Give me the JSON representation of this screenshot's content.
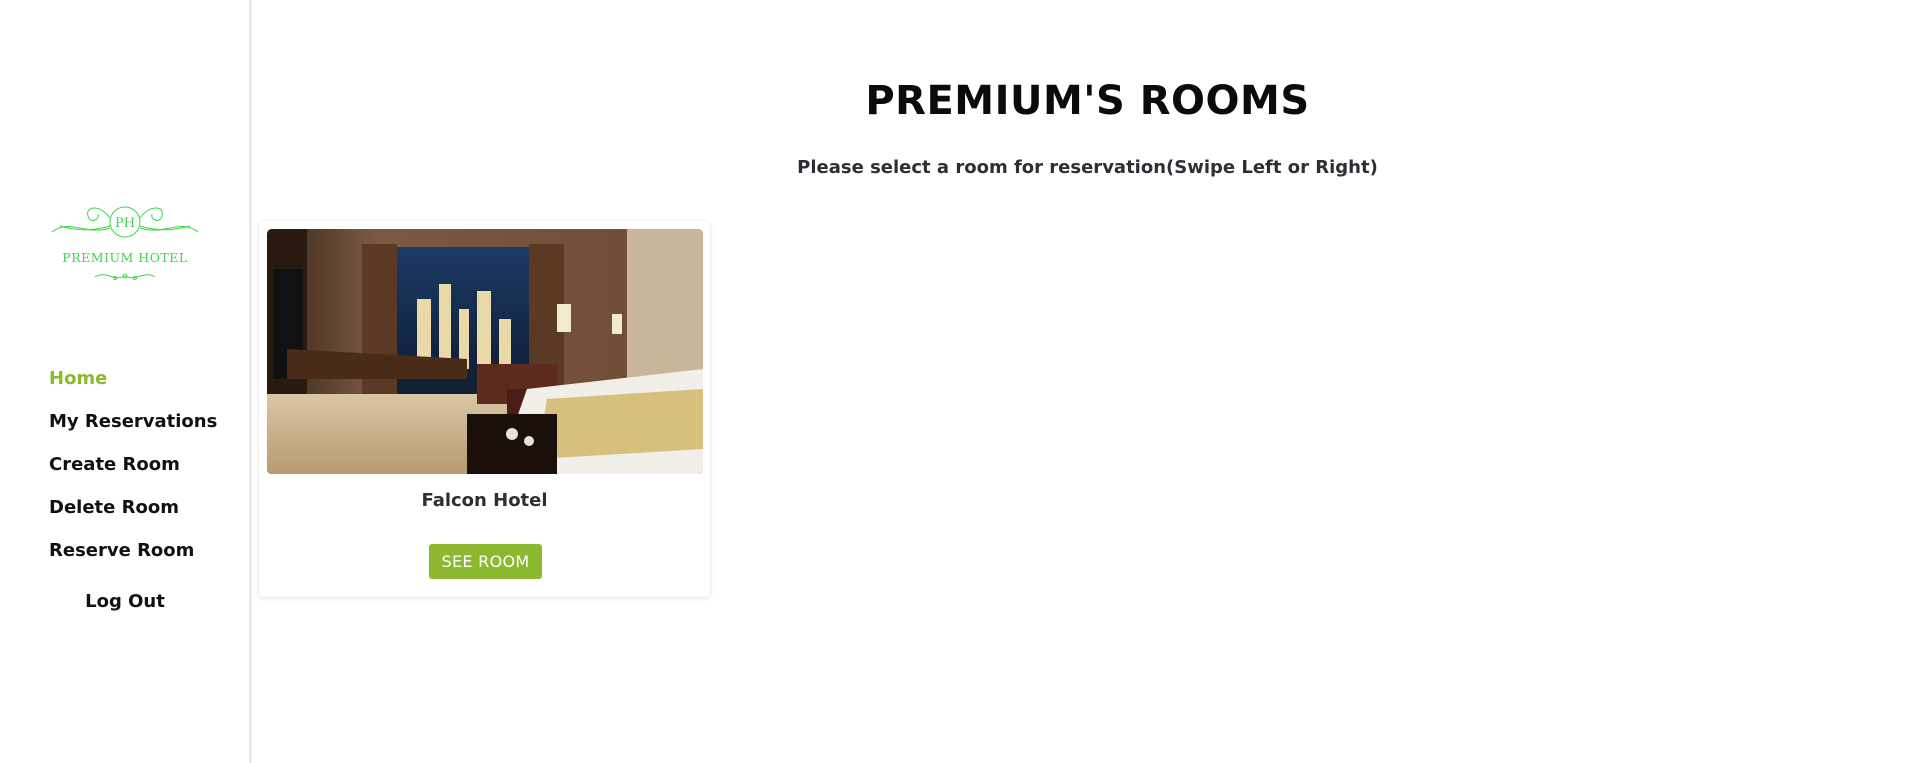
{
  "sidebar": {
    "logo": {
      "monogram": "PH",
      "name": "PREMIUM HOTEL",
      "color": "#3fd44a"
    },
    "nav": [
      {
        "label": "Home",
        "active": true
      },
      {
        "label": "My Reservations",
        "active": false
      },
      {
        "label": "Create Room",
        "active": false
      },
      {
        "label": "Delete Room",
        "active": false
      },
      {
        "label": "Reserve Room",
        "active": false
      }
    ],
    "logout_label": "Log Out",
    "active_color": "#8cb92f"
  },
  "main": {
    "title": "PREMIUM'S ROOMS",
    "subtitle": "Please select a room for reservation(Swipe Left or Right)"
  },
  "rooms": [
    {
      "name": "Falcon Hotel",
      "image": "hotel-room-photo",
      "button_label": "SEE ROOM"
    }
  ],
  "colors": {
    "accent": "#8cb92f",
    "logo_green": "#3fd44a"
  }
}
